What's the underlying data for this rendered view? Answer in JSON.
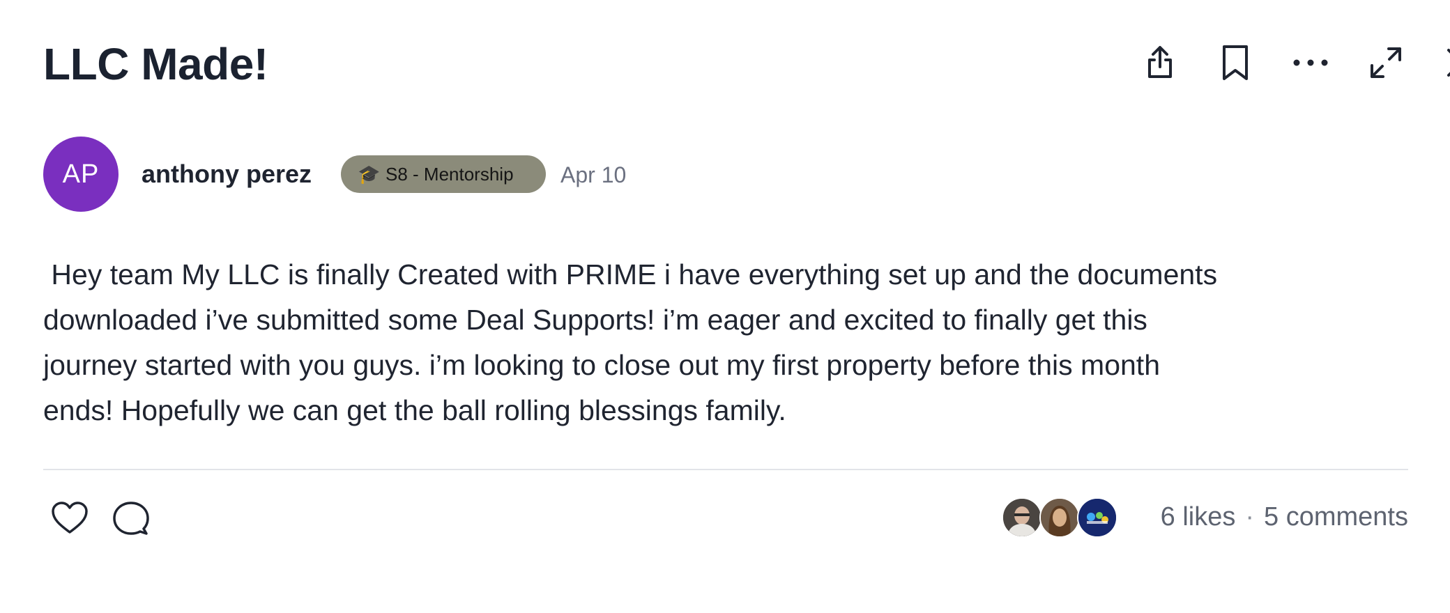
{
  "post": {
    "title": "LLC Made!",
    "author": {
      "initials": "AP",
      "name": "anthony perez",
      "avatar_color": "#7a2fbf"
    },
    "badge": {
      "icon": "graduation-cap-icon",
      "icon_glyph": "🎓",
      "label": "S8 - Mentorship",
      "color": "#8b8b7a"
    },
    "date": "Apr 10",
    "body": " Hey team My LLC is finally Created with PRIME i have everything set up and the documents\ndownloaded i’ve submitted some Deal Supports! i’m eager and excited to finally get this\njourney started with you guys. i’m looking to close out my first property before this month\nends! Hopefully we can get the ball rolling blessings family."
  },
  "toolbar": {
    "icons": [
      "share-icon",
      "bookmark-icon",
      "more-icon",
      "expand-icon",
      "close-icon"
    ]
  },
  "footer": {
    "likes": "6 likes",
    "separator": "·",
    "comments": "5 comments"
  }
}
